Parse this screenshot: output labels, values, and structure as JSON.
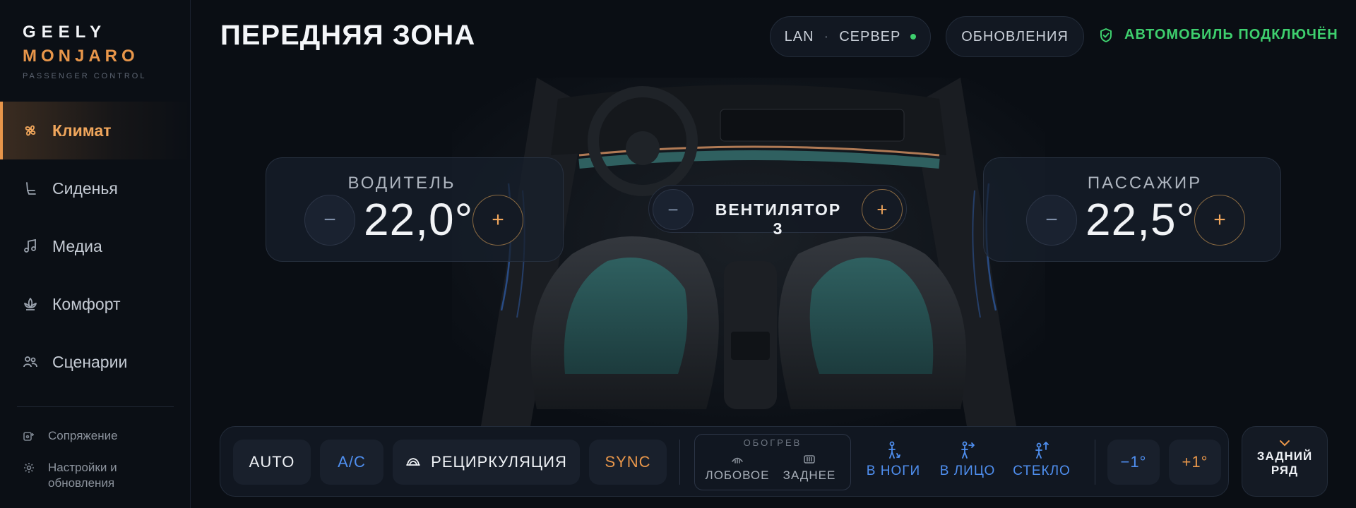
{
  "brand": {
    "line1": "GEELY",
    "line2": "MONJARO",
    "line3": "PASSENGER CONTROL"
  },
  "nav": {
    "items": [
      {
        "label": "Климат",
        "icon": "fan-icon",
        "active": true
      },
      {
        "label": "Сиденья",
        "icon": "seat-icon",
        "active": false
      },
      {
        "label": "Медиа",
        "icon": "music-note-icon",
        "active": false
      },
      {
        "label": "Комфорт",
        "icon": "lotus-icon",
        "active": false
      },
      {
        "label": "Сценарии",
        "icon": "users-icon",
        "active": false
      }
    ],
    "secondary": [
      {
        "label": "Сопряжение",
        "icon": "pairing-icon"
      },
      {
        "label": "Настройки и обновления",
        "icon": "settings-icon"
      }
    ]
  },
  "header": {
    "title": "ПЕРЕДНЯЯ ЗОНА",
    "connection": {
      "mode": "LAN",
      "target": "СЕРВЕР",
      "status_color": "#3ecf6e"
    },
    "updates_label": "ОБНОВЛЕНИЯ",
    "vehicle_status": "АВТОМОБИЛЬ ПОДКЛЮЧЁН"
  },
  "driver": {
    "label": "ВОДИТЕЛЬ",
    "temp": "22,0°",
    "minus": "−",
    "plus": "+"
  },
  "passenger": {
    "label": "ПАССАЖИР",
    "temp": "22,5°",
    "minus": "−",
    "plus": "+"
  },
  "fan": {
    "label": "ВЕНТИЛЯТОР 3",
    "minus": "−",
    "plus": "+"
  },
  "controls": {
    "auto": "AUTO",
    "ac": "A/C",
    "recirc": "РЕЦИРКУЛЯЦИЯ",
    "sync": "SYNC",
    "heating": {
      "title": "ОБОГРЕВ",
      "front": "ЛОБОВОЕ",
      "rear": "ЗАДНЕЕ"
    },
    "airflow": {
      "feet": "В НОГИ",
      "face": "В ЛИЦО",
      "glass": "СТЕКЛО"
    },
    "temp_down": "−1°",
    "temp_up": "+1°",
    "rear_row_line1": "ЗАДНИЙ",
    "rear_row_line2": "РЯД"
  },
  "colors": {
    "accent": "#e8964a",
    "blue": "#4f8ff0",
    "green": "#3ecf6e",
    "background": "#0a0e14"
  }
}
